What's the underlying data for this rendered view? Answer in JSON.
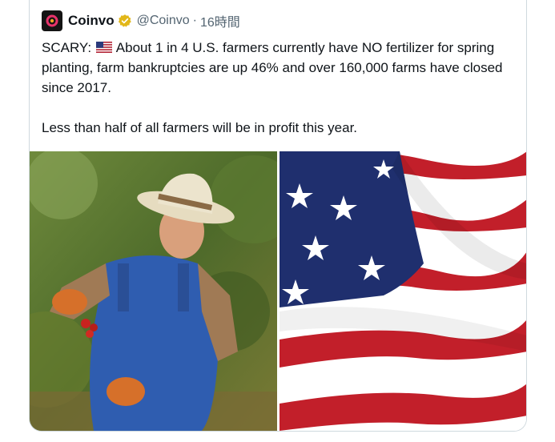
{
  "tweet": {
    "author": {
      "display_name": "Coinvo",
      "handle": "@Coinvo",
      "verified": true,
      "avatar_icon": "coinvo-logo-icon",
      "verified_icon": "verified-badge-icon"
    },
    "separator": "·",
    "time": "16時間",
    "text": {
      "prefix": "SCARY:",
      "flag_icon": "us-flag-emoji-icon",
      "line1": "About 1 in 4 U.S. farmers currently have NO fertilizer for spring planting, farm bankruptcies are up 46% and over 160,000 farms have closed since 2017.",
      "line2": "Less than half of all farmers will be in profit this year."
    },
    "media": [
      {
        "kind": "photo",
        "icon": "farmer-photo"
      },
      {
        "kind": "photo",
        "icon": "american-flag-photo"
      }
    ]
  },
  "colors": {
    "text": "#0f1419",
    "secondary": "#536471",
    "border": "#cfd9de",
    "verified_gold": "#e2b719",
    "flag_red": "#b22234",
    "flag_blue": "#1f2f6e"
  }
}
